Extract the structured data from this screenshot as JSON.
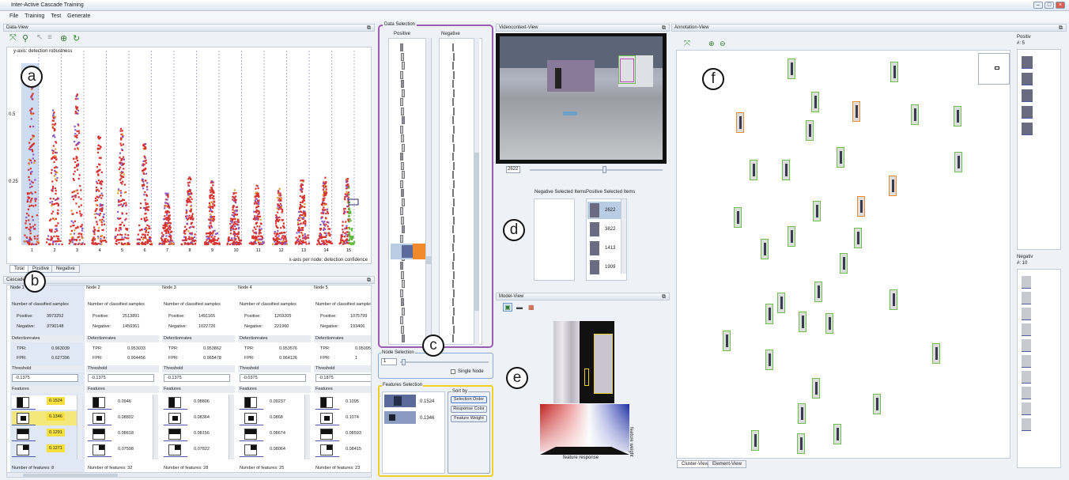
{
  "app": {
    "title": "Inter-Active Cascade Training",
    "menu": [
      "File",
      "Training",
      "Test",
      "Generate"
    ]
  },
  "panels": {
    "data_view": "Data-View",
    "cascade": "Cascade",
    "data_selection": "Data Selection",
    "video": "Videocontext-View",
    "annotation": "Annotation-View",
    "model": "Model-View",
    "node_selection": "Node Selection",
    "features_selection": "Features Selection"
  },
  "data_view": {
    "ylabel": "y-axis: detection robustness",
    "xlabel": "x-axis per node: detection confidence",
    "yticks": [
      "0.5",
      "0.25",
      "0"
    ],
    "tabs": [
      "Total",
      "Positive",
      "Negative"
    ],
    "node_numbers": [
      "1",
      "2",
      "3",
      "4",
      "5",
      "6",
      "7",
      "8",
      "9",
      "10",
      "11",
      "12",
      "13",
      "14",
      "15"
    ],
    "heights": [
      0.85,
      0.72,
      0.82,
      0.58,
      0.62,
      0.56,
      0.28,
      0.36,
      0.34,
      0.3,
      0.32,
      0.3,
      0.35,
      0.36,
      0.36
    ]
  },
  "callouts": [
    "a",
    "b",
    "c",
    "d",
    "e",
    "f"
  ],
  "cascade_nodes": [
    {
      "title": "Node 1",
      "nsamples": "Number of classified samples",
      "pos_label": "Positive:",
      "pos": "3973252",
      "neg_label": "Negative:",
      "neg": "3790148",
      "det": "Detectionrates",
      "tpr_label": "TPR:",
      "tpr": "0.963039",
      "fpr_label": "FPR:",
      "fpr": "0.627396",
      "thr_label": "Threshold",
      "thr": "-0.1375",
      "feat_label": "Features",
      "feats": [
        "0.1524",
        "0.1346",
        "0.1291",
        "0.1271"
      ],
      "count": "Number of features: 8"
    },
    {
      "title": "Node 2",
      "nsamples": "Number of classified samples",
      "pos_label": "Positive:",
      "pos": "2513891",
      "neg_label": "Negative:",
      "neg": "1459361",
      "det": "Detectionrates",
      "tpr_label": "TPR:",
      "tpr": "0.953033",
      "fpr_label": "FPR:",
      "fpr": "0.904456",
      "thr_label": "Threshold",
      "thr": "-0.1375",
      "feat_label": "Features",
      "feats": [
        "0.0946",
        "0.08802",
        "0.08618",
        "0.07598"
      ],
      "count": "Number of features: 32"
    },
    {
      "title": "Node 3",
      "nsamples": "Number of classified samples",
      "pos_label": "Positive:",
      "pos": "1491165",
      "neg_label": "Negative:",
      "neg": "1022726",
      "det": "Detectionrates",
      "tpr_label": "TPR:",
      "tpr": "0.953862",
      "fpr_label": "FPR:",
      "fpr": "0.965478",
      "thr_label": "Threshold",
      "thr": "-0.1375",
      "feat_label": "Features",
      "feats": [
        "0.08806",
        "0.08364",
        "0.08156",
        "0.07822"
      ],
      "count": "Number of features: 28"
    },
    {
      "title": "Node 4",
      "nsamples": "Number of classified samples",
      "pos_label": "Positive:",
      "pos": "1269205",
      "neg_label": "Negative:",
      "neg": "221960",
      "det": "Detectionrates",
      "tpr_label": "TPR:",
      "tpr": "0.953576",
      "fpr_label": "FPR:",
      "fpr": "0.964126",
      "thr_label": "Threshold",
      "thr": "-0.0375",
      "feat_label": "Features",
      "feats": [
        "0.09237",
        "0.0868",
        "0.08674",
        "0.08064"
      ],
      "count": "Number of features: 25"
    },
    {
      "title": "Node 5",
      "nsamples": "Number of classified samples",
      "pos_label": "Positive:",
      "pos": "1075799",
      "neg_label": "Negative:",
      "neg": "193406",
      "det": "Detectionrates",
      "tpr_label": "TPR:",
      "tpr": "0.950951",
      "fpr_label": "FPR:",
      "fpr": "1",
      "thr_label": "Threshold",
      "thr": "-0.1875",
      "feat_label": "Features",
      "feats": [
        "0.1095",
        "0.1074",
        "0.08593",
        "0.08415"
      ],
      "count": "Number of features: 23"
    }
  ],
  "data_selection": {
    "positive": "Positive",
    "negative": "Negative"
  },
  "video": {
    "frame": "2622"
  },
  "selected_items": {
    "neg_label": "Negative Selected Items",
    "pos_label": "Positive Selected Items",
    "items": [
      "2622",
      "3822",
      "1413",
      "1909"
    ]
  },
  "node_selection": {
    "value": "1",
    "single_node": "Single Node"
  },
  "features_selection": {
    "values": [
      "0.1524",
      "0.1346"
    ],
    "sort_by": "Sort by",
    "buttons": [
      "Selection Order",
      "Response Color",
      "Feature Weight"
    ]
  },
  "model": {
    "xaxis": "feature response",
    "yaxis": "feature weight"
  },
  "annotation": {
    "pos_label": "Positiv",
    "pos_count": "#:  5",
    "neg_label": "Negativ",
    "neg_count": "#:  10",
    "tabs": [
      "Cluster-View",
      "Element-View"
    ]
  },
  "colors": {
    "accent": "#7b3f9a",
    "selection": "#f0d020",
    "positive": "#6fbf4f",
    "negative_sel": "#f08a2a",
    "scatter": "#d8322e"
  }
}
